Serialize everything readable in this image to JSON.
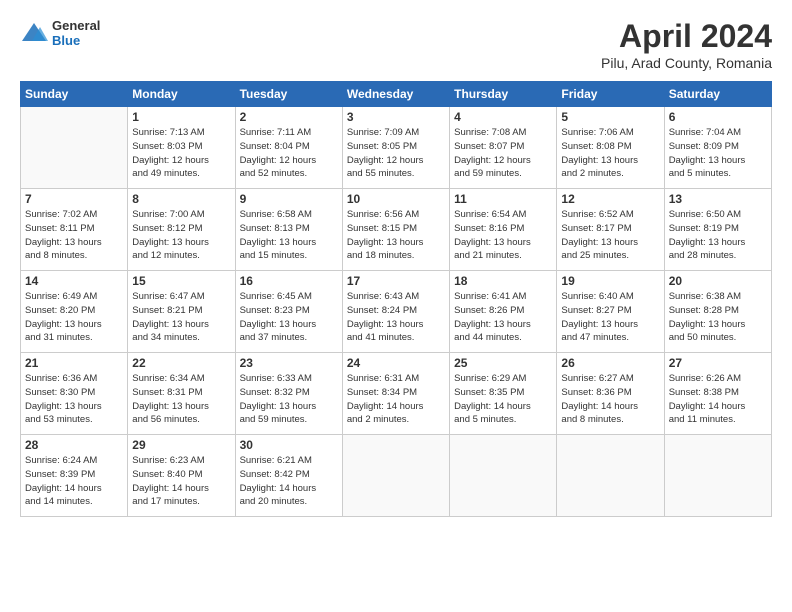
{
  "header": {
    "logo_general": "General",
    "logo_blue": "Blue",
    "month_title": "April 2024",
    "location": "Pilu, Arad County, Romania"
  },
  "weekdays": [
    "Sunday",
    "Monday",
    "Tuesday",
    "Wednesday",
    "Thursday",
    "Friday",
    "Saturday"
  ],
  "weeks": [
    [
      {
        "day": "",
        "info": ""
      },
      {
        "day": "1",
        "info": "Sunrise: 7:13 AM\nSunset: 8:03 PM\nDaylight: 12 hours\nand 49 minutes."
      },
      {
        "day": "2",
        "info": "Sunrise: 7:11 AM\nSunset: 8:04 PM\nDaylight: 12 hours\nand 52 minutes."
      },
      {
        "day": "3",
        "info": "Sunrise: 7:09 AM\nSunset: 8:05 PM\nDaylight: 12 hours\nand 55 minutes."
      },
      {
        "day": "4",
        "info": "Sunrise: 7:08 AM\nSunset: 8:07 PM\nDaylight: 12 hours\nand 59 minutes."
      },
      {
        "day": "5",
        "info": "Sunrise: 7:06 AM\nSunset: 8:08 PM\nDaylight: 13 hours\nand 2 minutes."
      },
      {
        "day": "6",
        "info": "Sunrise: 7:04 AM\nSunset: 8:09 PM\nDaylight: 13 hours\nand 5 minutes."
      }
    ],
    [
      {
        "day": "7",
        "info": "Sunrise: 7:02 AM\nSunset: 8:11 PM\nDaylight: 13 hours\nand 8 minutes."
      },
      {
        "day": "8",
        "info": "Sunrise: 7:00 AM\nSunset: 8:12 PM\nDaylight: 13 hours\nand 12 minutes."
      },
      {
        "day": "9",
        "info": "Sunrise: 6:58 AM\nSunset: 8:13 PM\nDaylight: 13 hours\nand 15 minutes."
      },
      {
        "day": "10",
        "info": "Sunrise: 6:56 AM\nSunset: 8:15 PM\nDaylight: 13 hours\nand 18 minutes."
      },
      {
        "day": "11",
        "info": "Sunrise: 6:54 AM\nSunset: 8:16 PM\nDaylight: 13 hours\nand 21 minutes."
      },
      {
        "day": "12",
        "info": "Sunrise: 6:52 AM\nSunset: 8:17 PM\nDaylight: 13 hours\nand 25 minutes."
      },
      {
        "day": "13",
        "info": "Sunrise: 6:50 AM\nSunset: 8:19 PM\nDaylight: 13 hours\nand 28 minutes."
      }
    ],
    [
      {
        "day": "14",
        "info": "Sunrise: 6:49 AM\nSunset: 8:20 PM\nDaylight: 13 hours\nand 31 minutes."
      },
      {
        "day": "15",
        "info": "Sunrise: 6:47 AM\nSunset: 8:21 PM\nDaylight: 13 hours\nand 34 minutes."
      },
      {
        "day": "16",
        "info": "Sunrise: 6:45 AM\nSunset: 8:23 PM\nDaylight: 13 hours\nand 37 minutes."
      },
      {
        "day": "17",
        "info": "Sunrise: 6:43 AM\nSunset: 8:24 PM\nDaylight: 13 hours\nand 41 minutes."
      },
      {
        "day": "18",
        "info": "Sunrise: 6:41 AM\nSunset: 8:26 PM\nDaylight: 13 hours\nand 44 minutes."
      },
      {
        "day": "19",
        "info": "Sunrise: 6:40 AM\nSunset: 8:27 PM\nDaylight: 13 hours\nand 47 minutes."
      },
      {
        "day": "20",
        "info": "Sunrise: 6:38 AM\nSunset: 8:28 PM\nDaylight: 13 hours\nand 50 minutes."
      }
    ],
    [
      {
        "day": "21",
        "info": "Sunrise: 6:36 AM\nSunset: 8:30 PM\nDaylight: 13 hours\nand 53 minutes."
      },
      {
        "day": "22",
        "info": "Sunrise: 6:34 AM\nSunset: 8:31 PM\nDaylight: 13 hours\nand 56 minutes."
      },
      {
        "day": "23",
        "info": "Sunrise: 6:33 AM\nSunset: 8:32 PM\nDaylight: 13 hours\nand 59 minutes."
      },
      {
        "day": "24",
        "info": "Sunrise: 6:31 AM\nSunset: 8:34 PM\nDaylight: 14 hours\nand 2 minutes."
      },
      {
        "day": "25",
        "info": "Sunrise: 6:29 AM\nSunset: 8:35 PM\nDaylight: 14 hours\nand 5 minutes."
      },
      {
        "day": "26",
        "info": "Sunrise: 6:27 AM\nSunset: 8:36 PM\nDaylight: 14 hours\nand 8 minutes."
      },
      {
        "day": "27",
        "info": "Sunrise: 6:26 AM\nSunset: 8:38 PM\nDaylight: 14 hours\nand 11 minutes."
      }
    ],
    [
      {
        "day": "28",
        "info": "Sunrise: 6:24 AM\nSunset: 8:39 PM\nDaylight: 14 hours\nand 14 minutes."
      },
      {
        "day": "29",
        "info": "Sunrise: 6:23 AM\nSunset: 8:40 PM\nDaylight: 14 hours\nand 17 minutes."
      },
      {
        "day": "30",
        "info": "Sunrise: 6:21 AM\nSunset: 8:42 PM\nDaylight: 14 hours\nand 20 minutes."
      },
      {
        "day": "",
        "info": ""
      },
      {
        "day": "",
        "info": ""
      },
      {
        "day": "",
        "info": ""
      },
      {
        "day": "",
        "info": ""
      }
    ]
  ]
}
